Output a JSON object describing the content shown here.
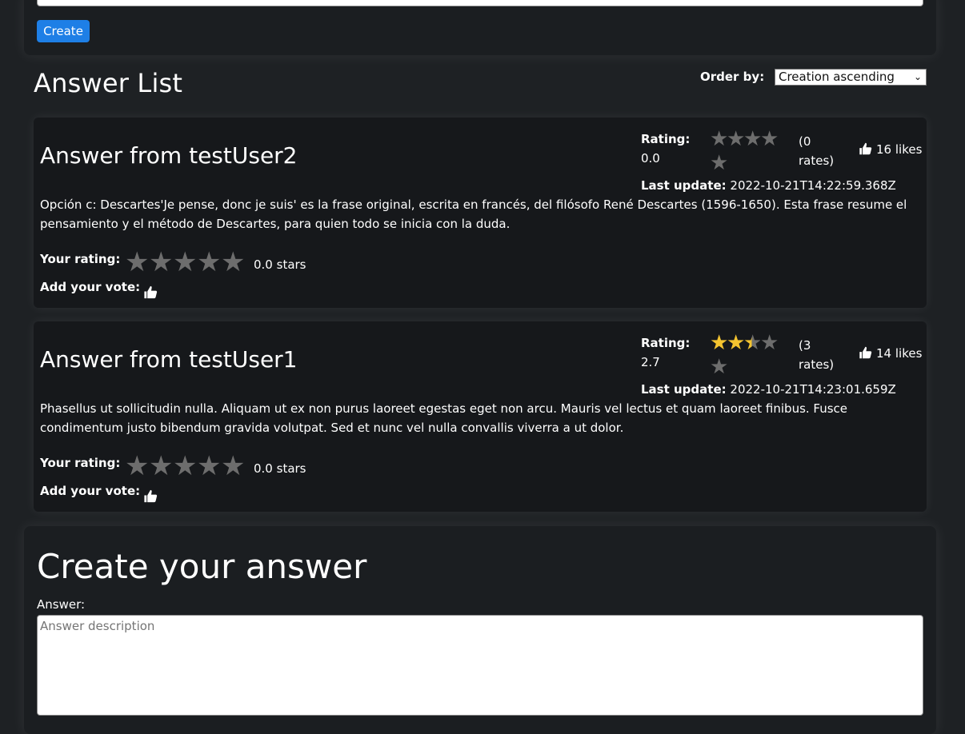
{
  "top_form": {
    "create_button": "Create"
  },
  "answer_list": {
    "title": "Answer List",
    "order_by_label": "Order by:",
    "order_by_selected": "Creation ascending",
    "order_by_chevron": "⌄"
  },
  "answers": [
    {
      "title": "Answer from testUser2",
      "rating_label": "Rating:",
      "rating_value": "0.0",
      "rating_stars_fraction": 0,
      "rates_count": "(0 rates)",
      "likes": "16 likes",
      "last_update_label": "Last update:",
      "last_update_value": "2022-10-21T14:22:59.368Z",
      "body": "Opción c: Descartes'Je pense, donc je suis' es la frase original, escrita en francés, del filósofo René Descartes (1596-1650). Esta frase resume el pensamiento y el método de Descartes, para quien todo se inicia con la duda.",
      "your_rating_label": "Your rating:",
      "your_rating_text": "0.0 stars",
      "add_vote_label": "Add your vote:"
    },
    {
      "title": "Answer from testUser1",
      "rating_label": "Rating:",
      "rating_value": "2.7",
      "rating_stars_fraction": 0.54,
      "rates_count": "(3 rates)",
      "likes": "14 likes",
      "last_update_label": "Last update:",
      "last_update_value": "2022-10-21T14:23:01.659Z",
      "body": "Phasellus ut sollicitudin nulla. Aliquam ut ex non purus laoreet egestas eget non arcu. Mauris vel lectus et quam laoreet finibus. Fusce condimentum justo bibendum gravida volutpat. Sed et nunc vel nulla convallis viverra a ut dolor.",
      "your_rating_label": "Your rating:",
      "your_rating_text": "0.0 stars",
      "add_vote_label": "Add your vote:"
    }
  ],
  "create_answer": {
    "title": "Create your answer",
    "field_label": "Answer:",
    "placeholder": "Answer description",
    "value": ""
  },
  "icons": {
    "star": "★",
    "thumb": "thumbs-up-icon"
  },
  "colors": {
    "background": "#1e2124",
    "card": "#16181b",
    "accent_button": "#1e7fe6",
    "star_filled": "#f4c430",
    "star_empty": "#6d6d6d"
  }
}
